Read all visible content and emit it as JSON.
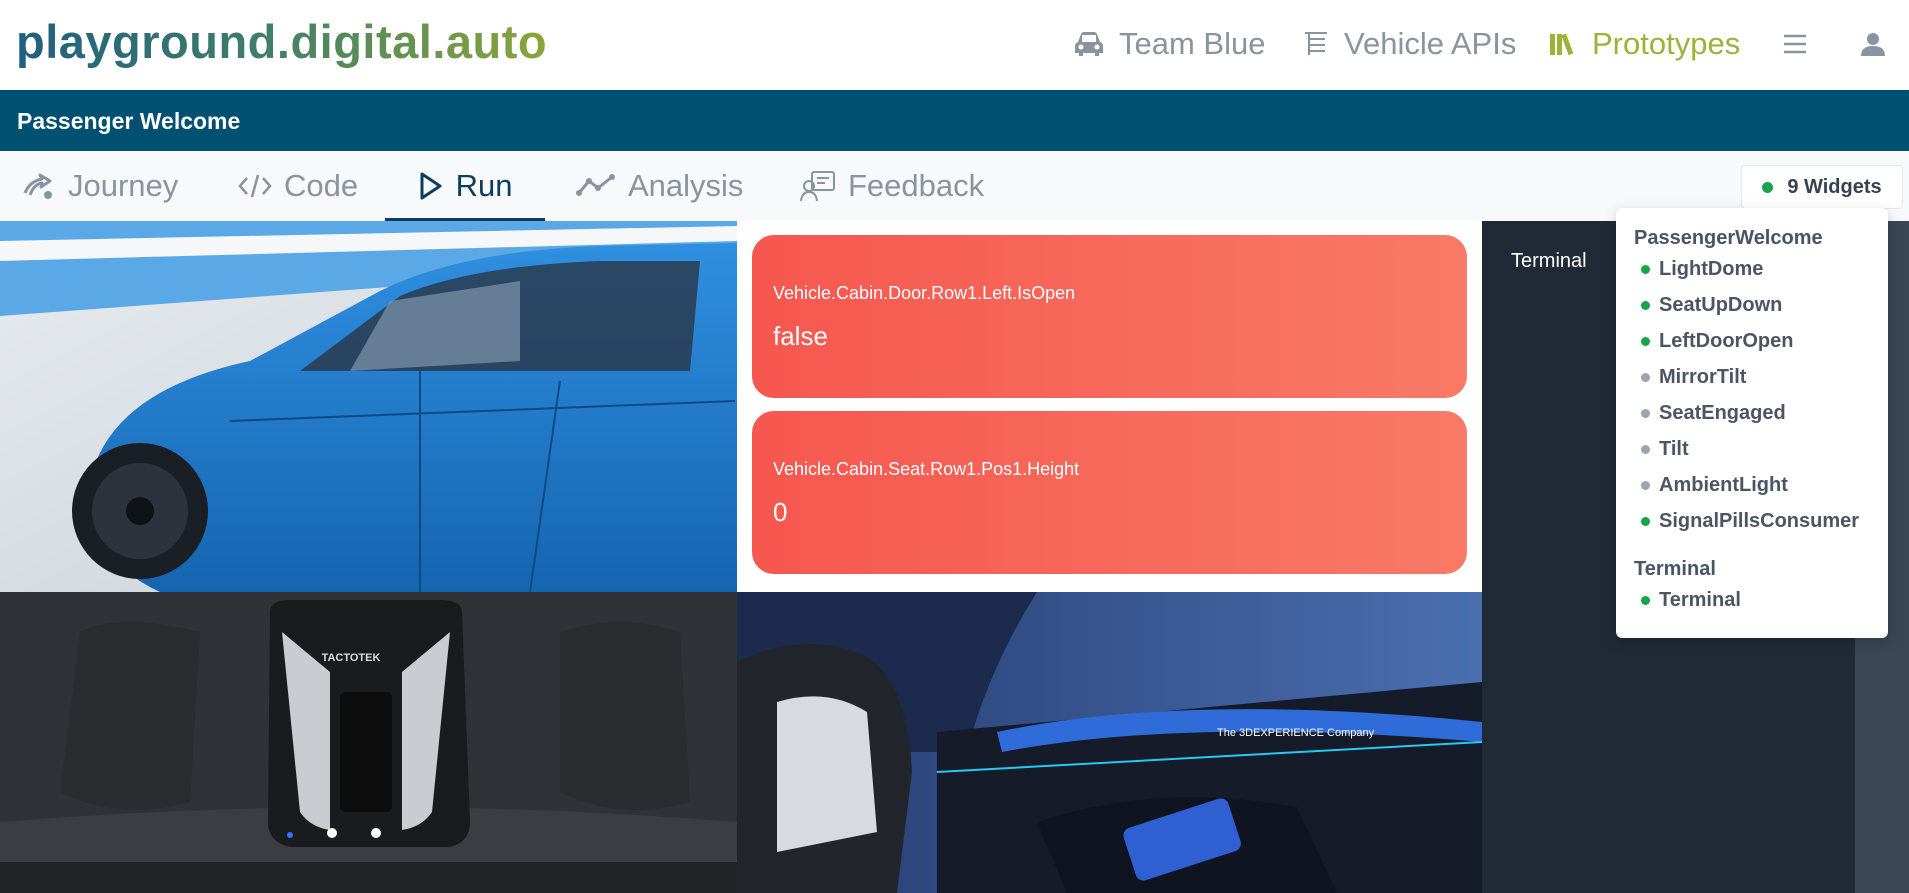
{
  "app": {
    "logo_text": "playground.digital.auto"
  },
  "nav": {
    "team_label": "Team Blue",
    "apis_label": "Vehicle APIs",
    "prototypes_label": "Prototypes"
  },
  "prototype": {
    "title": "Passenger Welcome"
  },
  "tabs": [
    {
      "label": "Journey"
    },
    {
      "label": "Code"
    },
    {
      "label": "Run"
    },
    {
      "label": "Analysis"
    },
    {
      "label": "Feedback"
    }
  ],
  "active_tab": "Run",
  "widgets_button": {
    "label": "9 Widgets"
  },
  "signals": [
    {
      "name": "Vehicle.Cabin.Door.Row1.Left.IsOpen",
      "value": "false"
    },
    {
      "name": "Vehicle.Cabin.Seat.Row1.Pos1.Height",
      "value": "0"
    }
  ],
  "terminal": {
    "title": "Terminal"
  },
  "widget_menu": {
    "groups": [
      {
        "label": "PassengerWelcome",
        "items": [
          {
            "label": "LightDome",
            "active": true
          },
          {
            "label": "SeatUpDown",
            "active": true
          },
          {
            "label": "LeftDoorOpen",
            "active": true
          },
          {
            "label": "MirrorTilt",
            "active": false
          },
          {
            "label": "SeatEngaged",
            "active": false
          },
          {
            "label": "Tilt",
            "active": false
          },
          {
            "label": "AmbientLight",
            "active": false
          },
          {
            "label": "SignalPillsConsumer",
            "active": true
          }
        ]
      },
      {
        "label": "Terminal",
        "items": [
          {
            "label": "Terminal",
            "active": true
          }
        ]
      }
    ]
  },
  "images": {
    "dome_brand_text": "TACTOTEK",
    "interior_brand_text": "The 3DEXPERIENCE Company"
  },
  "colors": {
    "title_bar": "#005072",
    "active_nav": "#9cb33a",
    "signal_card_start": "#f6574f",
    "signal_card_end": "#f87a67",
    "status_on": "#16a34a",
    "status_off": "#9ca3af",
    "terminal_bg": "#202a36"
  }
}
